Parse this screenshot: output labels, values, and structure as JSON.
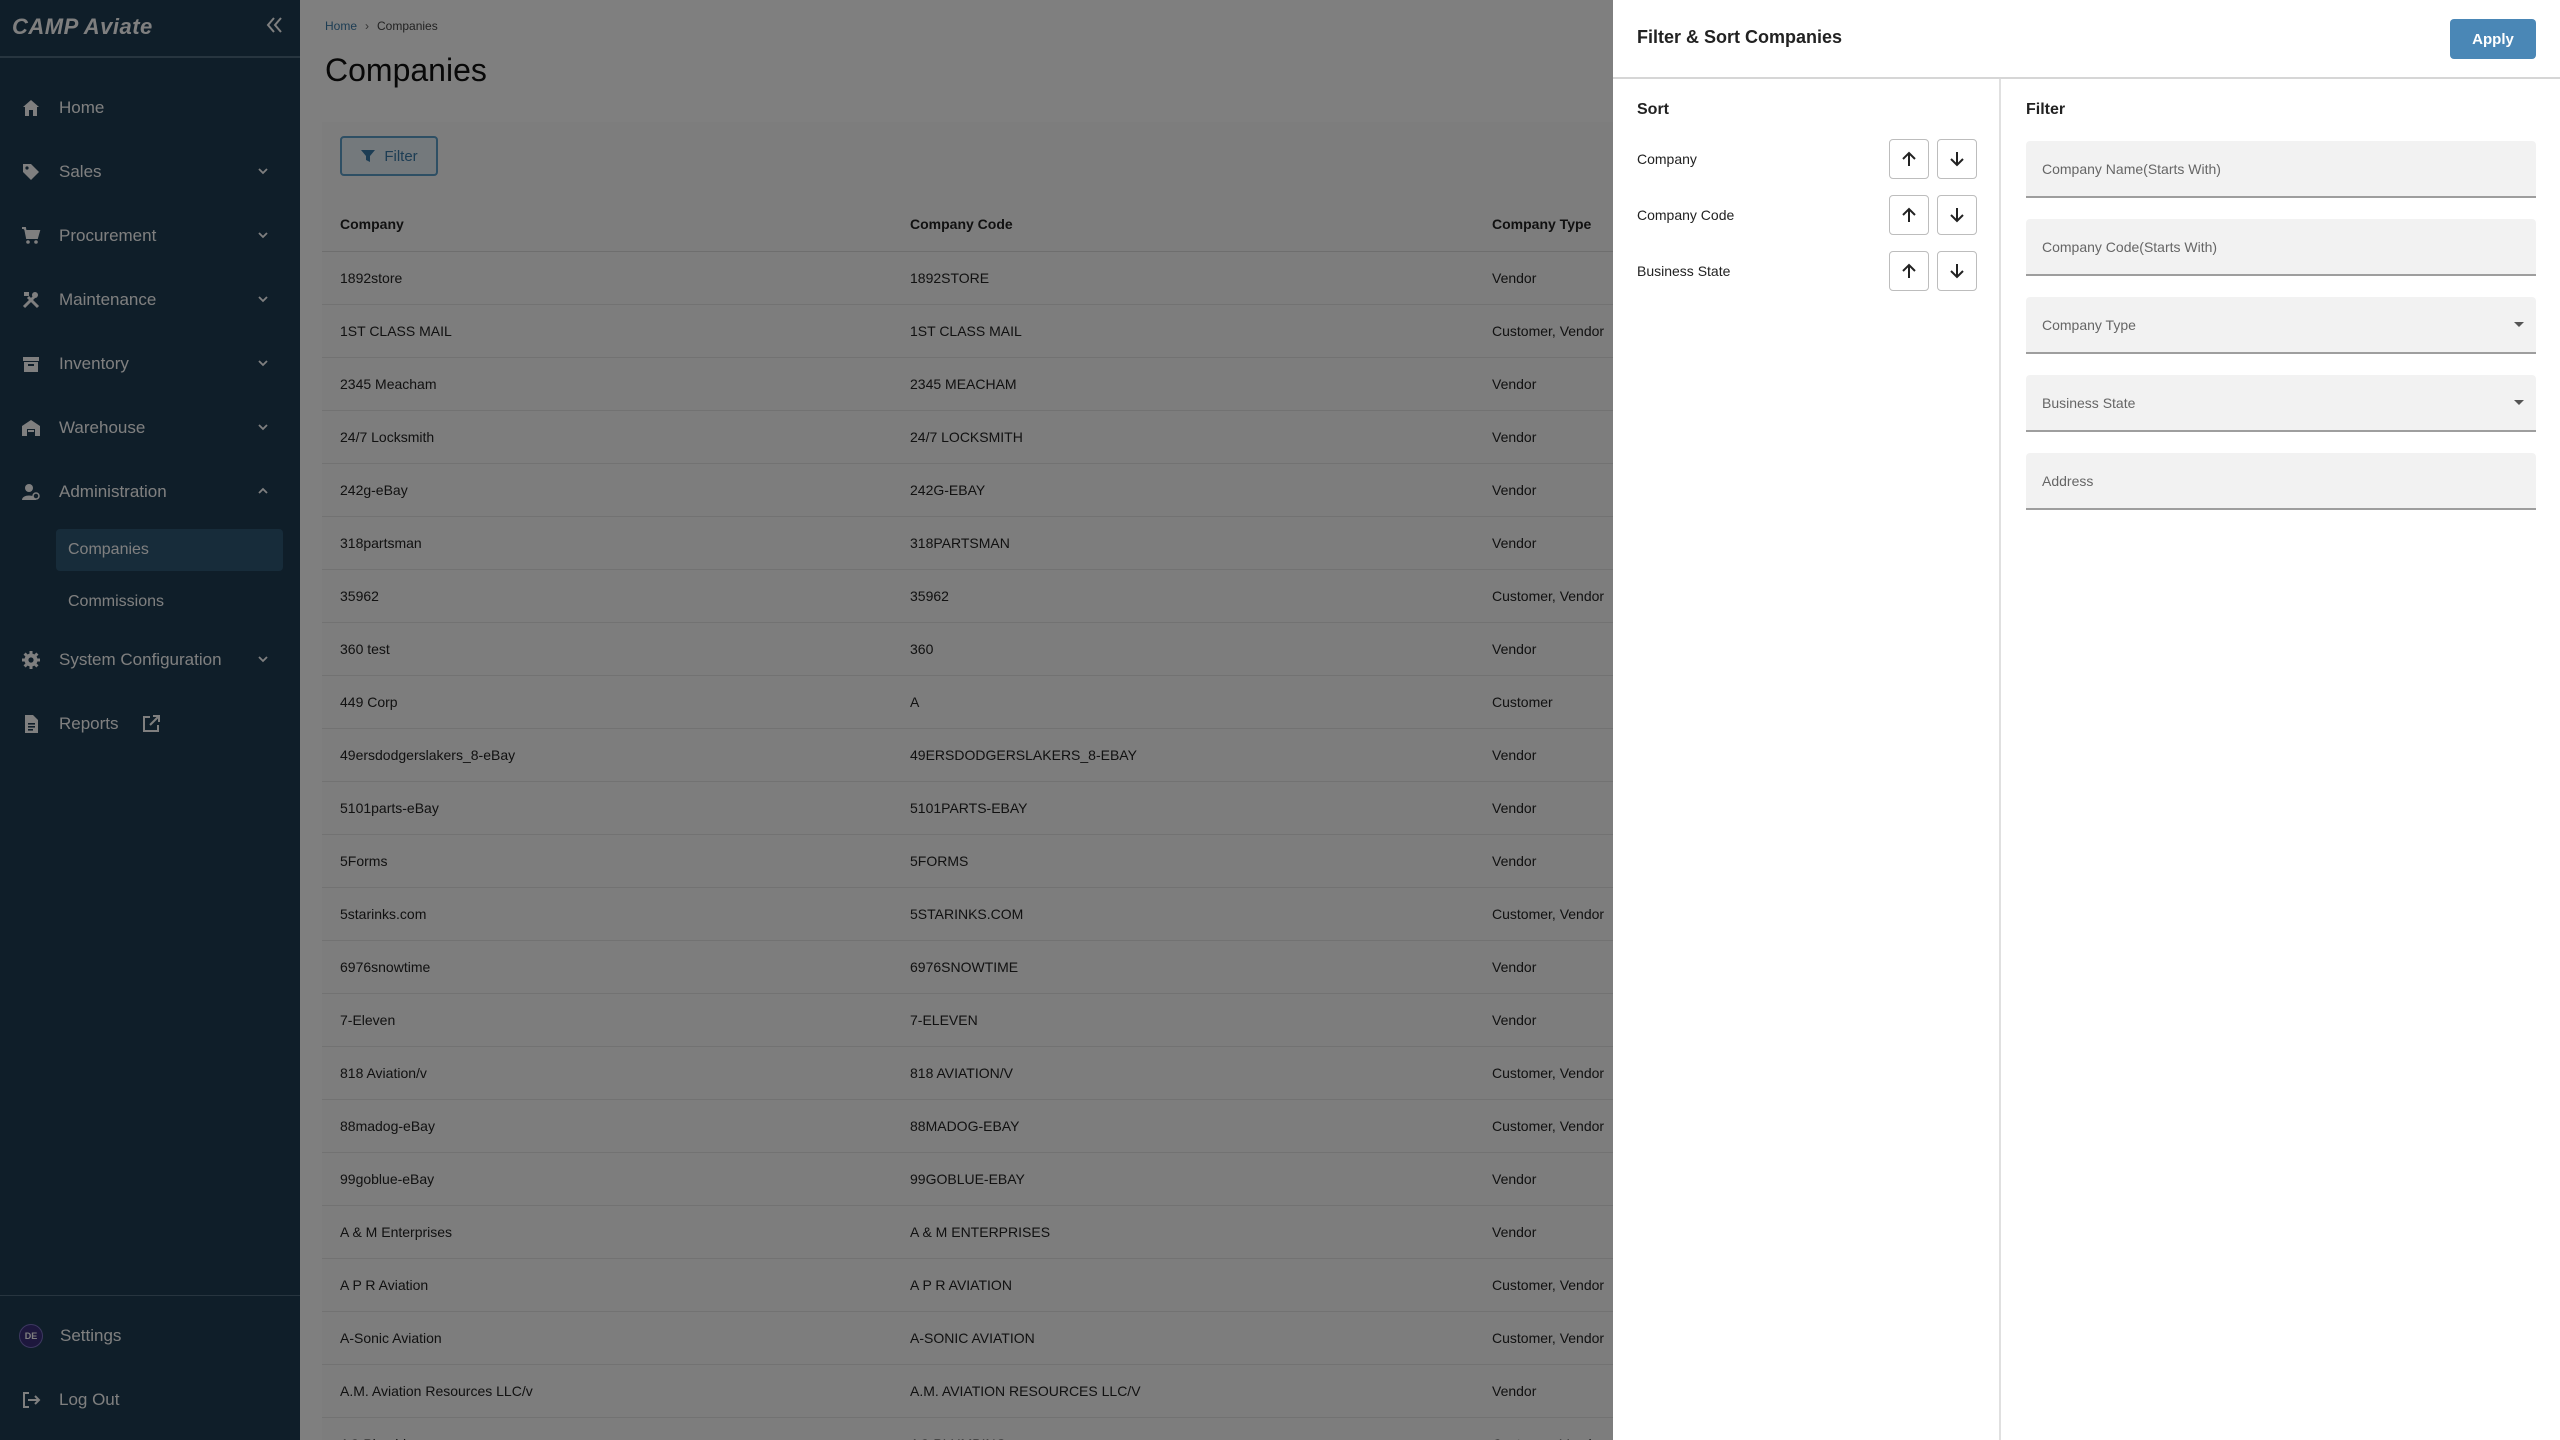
{
  "sidebar": {
    "logo": "CAMP Aviate",
    "items": [
      {
        "label": "Home",
        "icon": "home-icon"
      },
      {
        "label": "Sales",
        "icon": "tag-icon"
      },
      {
        "label": "Procurement",
        "icon": "cart-icon"
      },
      {
        "label": "Maintenance",
        "icon": "tools-icon"
      },
      {
        "label": "Inventory",
        "icon": "archive-icon"
      },
      {
        "label": "Warehouse",
        "icon": "warehouse-icon"
      },
      {
        "label": "Administration",
        "icon": "admin-icon"
      },
      {
        "label": "System Configuration",
        "icon": "gear-icon"
      },
      {
        "label": "Reports",
        "icon": "document-icon"
      }
    ],
    "sub_items": [
      {
        "label": "Companies",
        "active": true
      },
      {
        "label": "Commissions",
        "active": false
      }
    ],
    "bottom": {
      "settings_label": "Settings",
      "avatar_initials": "DE",
      "logout_label": "Log Out"
    }
  },
  "breadcrumb": {
    "home": "Home",
    "current": "Companies"
  },
  "page": {
    "title": "Companies",
    "filter_button": "Filter"
  },
  "table": {
    "columns": [
      "Company",
      "Company Code",
      "Company Type"
    ],
    "rows": [
      [
        "1892store",
        "1892STORE",
        "Vendor"
      ],
      [
        "1ST CLASS MAIL",
        "1ST CLASS MAIL",
        "Customer, Vendor"
      ],
      [
        "2345 Meacham",
        "2345 MEACHAM",
        "Vendor"
      ],
      [
        "24/7 Locksmith",
        "24/7 LOCKSMITH",
        "Vendor"
      ],
      [
        "242g-eBay",
        "242G-EBAY",
        "Vendor"
      ],
      [
        "318partsman",
        "318PARTSMAN",
        "Vendor"
      ],
      [
        "35962",
        "35962",
        "Customer, Vendor"
      ],
      [
        "360 test",
        "360",
        "Vendor"
      ],
      [
        "449 Corp",
        "A",
        "Customer"
      ],
      [
        "49ersdodgerslakers_8-eBay",
        "49ERSDODGERSLAKERS_8-EBAY",
        "Vendor"
      ],
      [
        "5101parts-eBay",
        "5101PARTS-EBAY",
        "Vendor"
      ],
      [
        "5Forms",
        "5FORMS",
        "Vendor"
      ],
      [
        "5starinks.com",
        "5STARINKS.COM",
        "Customer, Vendor"
      ],
      [
        "6976snowtime",
        "6976SNOWTIME",
        "Vendor"
      ],
      [
        "7-Eleven",
        "7-ELEVEN",
        "Vendor"
      ],
      [
        "818 Aviation/v",
        "818 AVIATION/V",
        "Customer, Vendor"
      ],
      [
        "88madog-eBay",
        "88MADOG-EBAY",
        "Customer, Vendor"
      ],
      [
        "99goblue-eBay",
        "99GOBLUE-EBAY",
        "Vendor"
      ],
      [
        "A & M Enterprises",
        "A & M ENTERPRISES",
        "Vendor"
      ],
      [
        "A P R Aviation",
        "A P R AVIATION",
        "Customer, Vendor"
      ],
      [
        "A-Sonic Aviation",
        "A-SONIC AVIATION",
        "Customer, Vendor"
      ],
      [
        "A.M. Aviation Resources LLC/v",
        "A.M. AVIATION RESOURCES LLC/V",
        "Vendor"
      ],
      [
        "AC Plumbing",
        "AC PLUMBING",
        "Customer, Vendor"
      ]
    ]
  },
  "drawer": {
    "title": "Filter & Sort Companies",
    "apply_label": "Apply",
    "sort_heading": "Sort",
    "sort_fields": [
      "Company",
      "Company Code",
      "Business State"
    ],
    "filter_heading": "Filter",
    "filters": {
      "company_name_placeholder": "Company Name(Starts With)",
      "company_code_placeholder": "Company Code(Starts With)",
      "company_type_label": "Company Type",
      "business_state_label": "Business State",
      "address_placeholder": "Address"
    }
  },
  "colors": {
    "sidebar_bg": "#1e3d53",
    "sidebar_active": "#2f5875",
    "accent": "#4a87b6",
    "overlay": "rgba(0,0,0,0.5)"
  }
}
